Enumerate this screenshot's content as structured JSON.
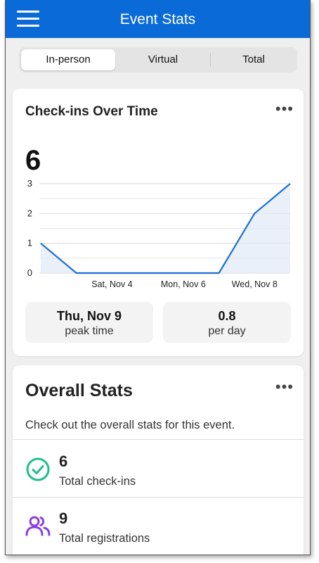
{
  "app": {
    "title": "Event Stats"
  },
  "tabs": [
    {
      "label": "In-person",
      "active": true
    },
    {
      "label": "Virtual",
      "active": false
    },
    {
      "label": "Total",
      "active": false
    }
  ],
  "checkins_card": {
    "title": "Check-ins Over Time",
    "more_label": "•••",
    "total": "6",
    "peak": {
      "value": "Thu, Nov 9",
      "label": "peak time"
    },
    "rate": {
      "value": "0.8",
      "label": "per day"
    }
  },
  "chart_data": {
    "type": "area",
    "x_tick_labels": [
      "Sat, Nov 4",
      "Mon, Nov 6",
      "Wed, Nov 8"
    ],
    "y_ticks": [
      "0",
      "1",
      "2",
      "3"
    ],
    "ylim": [
      0,
      3
    ],
    "values": [
      1,
      0,
      0,
      0,
      0,
      0,
      2,
      3
    ],
    "grid": true,
    "color": "#1a6fd4"
  },
  "overall_card": {
    "title": "Overall Stats",
    "more_label": "•••",
    "description": "Check out the overall stats for this event.",
    "items": [
      {
        "value": "6",
        "label": "Total check-ins",
        "icon": "check-circle-icon",
        "color": "#1dbf8a"
      },
      {
        "value": "9",
        "label": "Total registrations",
        "icon": "people-icon",
        "color": "#8a3ee0"
      }
    ]
  }
}
